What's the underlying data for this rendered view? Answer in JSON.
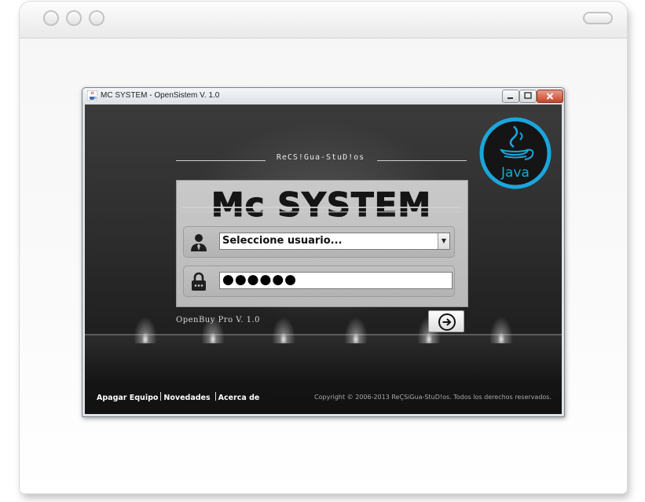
{
  "window": {
    "title": "MC SYSTEM - OpenSistem V. 1.0",
    "java_icon": "java-cup-icon"
  },
  "branding": {
    "studio": "ReCS!Gua-StuD!os",
    "logo_text": "Mc SYSTEM",
    "java_badge": "Java",
    "accent_color": "#19a4d8"
  },
  "login": {
    "user_placeholder": "Seleccione usuario...",
    "password_mask": "●●●●●●",
    "user_icon": "user-icon",
    "lock_icon": "lock-icon",
    "submit_icon": "arrow-right-circle-icon"
  },
  "footer": {
    "version": "OpenBuy Pro V. 1.0",
    "links": [
      "Apagar Equipo",
      "Novedades",
      "Acerca de"
    ],
    "copyright": "Copyright © 2006-2013 ReÇSiGua-StuD!os. Todos los derechos reservados."
  }
}
